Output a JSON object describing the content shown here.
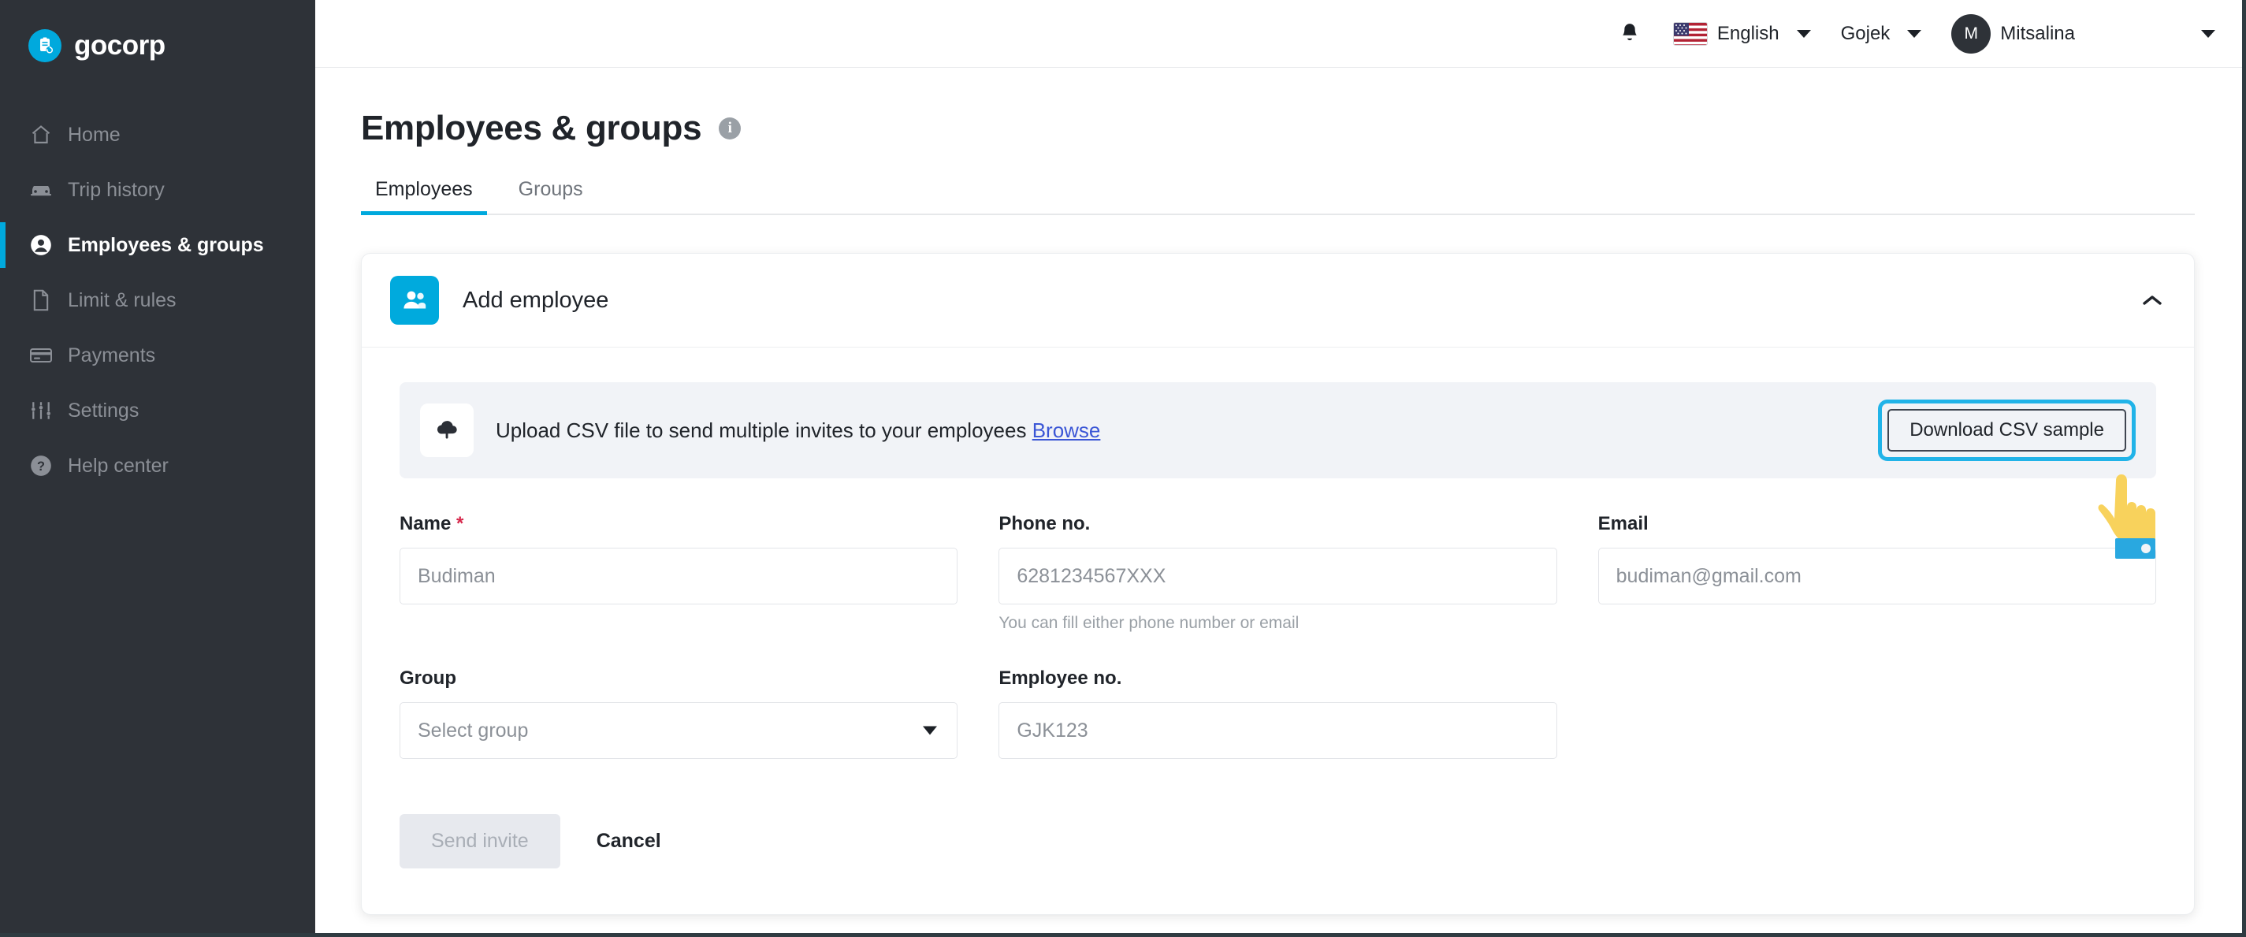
{
  "brand": {
    "name": "gocorp",
    "logo_icon": "gocorp-logo-icon",
    "accent_color": "#00a9dd",
    "sidebar_color": "#2e3238"
  },
  "sidebar": {
    "items": [
      {
        "label": "Home",
        "icon": "home-icon",
        "active": false
      },
      {
        "label": "Trip history",
        "icon": "car-icon",
        "active": false
      },
      {
        "label": "Employees & groups",
        "icon": "user-circle-icon",
        "active": true
      },
      {
        "label": "Limit & rules",
        "icon": "document-icon",
        "active": false
      },
      {
        "label": "Payments",
        "icon": "credit-card-icon",
        "active": false
      },
      {
        "label": "Settings",
        "icon": "sliders-icon",
        "active": false
      },
      {
        "label": "Help center",
        "icon": "question-circle-icon",
        "active": false
      }
    ]
  },
  "topbar": {
    "notification_icon": "bell-icon",
    "language": "English",
    "language_flag": "us-flag-icon",
    "organization": "Gojek",
    "user_name": "Mitsalina",
    "user_initial": "M"
  },
  "page": {
    "title": "Employees & groups",
    "info_icon": "info-icon",
    "info_glyph": "i",
    "tabs": [
      {
        "label": "Employees",
        "active": true
      },
      {
        "label": "Groups",
        "active": false
      }
    ]
  },
  "card": {
    "icon": "users-icon",
    "title": "Add employee",
    "collapse_icon": "chevron-up-icon"
  },
  "upload": {
    "icon": "cloud-upload-icon",
    "text": "Upload CSV file to send multiple invites to your employees",
    "browse_label": "Browse",
    "download_sample_label": "Download CSV sample",
    "highlight_color": "#21b3e8"
  },
  "form": {
    "name": {
      "label": "Name",
      "required_mark": "*",
      "value": "",
      "placeholder": "Budiman"
    },
    "phone": {
      "label": "Phone no.",
      "value": "",
      "placeholder": "6281234567XXX",
      "helper": "You can fill either phone number or email"
    },
    "email": {
      "label": "Email",
      "value": "",
      "placeholder": "budiman@gmail.com"
    },
    "group": {
      "label": "Group",
      "selected": "Select group",
      "caret_icon": "chevron-down-icon"
    },
    "employee_no": {
      "label": "Employee no.",
      "value": "",
      "placeholder": "GJK123"
    },
    "submit_label": "Send invite",
    "cancel_label": "Cancel"
  },
  "cursor": {
    "icon": "pointing-hand-cursor",
    "hand_color": "#f8d25c",
    "cuff_color": "#29a8e0"
  }
}
